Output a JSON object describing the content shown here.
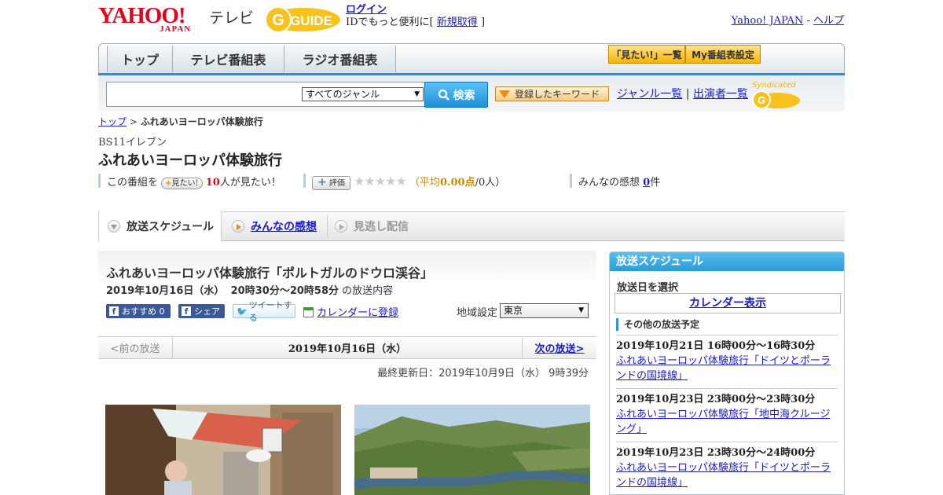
{
  "header": {
    "logo_text": "YAHOO!",
    "logo_sub": "JAPAN",
    "service": "テレビ",
    "gguide_logo": "GUIDE",
    "login": "ログイン",
    "login_note_pre": "IDでもっと便利に[",
    "register": "新規取得",
    "login_note_post": "]",
    "yahoo_japan": "Yahoo! JAPAN",
    "sep": "-",
    "help": "ヘルプ"
  },
  "nav": {
    "tabs": [
      "トップ",
      "テレビ番組表",
      "ラジオ番組表"
    ],
    "want_list": "「見たい!」一覧",
    "my_listing": "My番組表設定"
  },
  "search": {
    "genre": "すべてのジャンル",
    "button": "検索",
    "registered_keywords": "登録したキーワード",
    "genre_list": "ジャンル一覧",
    "divider": "|",
    "performer_list": "出演者一覧",
    "syndicated": "Syndicated"
  },
  "breadcrumb": {
    "home": "トップ",
    "sep": ">",
    "current": "ふれあいヨーロッパ体験旅行"
  },
  "program": {
    "channel": "BS11イレブン",
    "title": "ふれあいヨーロッパ体験旅行",
    "want_pre": "この番組を",
    "want_button": "見たい!",
    "want_count": "10",
    "want_post": "人が見たい！",
    "rate_button": "評価",
    "rating": 0,
    "rating_stars": "★★★★★",
    "avg_label": "（平均",
    "avg_value": "0.00点",
    "avg_post": "/0人）",
    "reviews_pre": "みんなの感想",
    "reviews_count": "0",
    "reviews_post": "件"
  },
  "subtabs": {
    "schedule": "放送スケジュール",
    "reviews": "みんなの感想",
    "stream": "見逃し配信"
  },
  "episode": {
    "title": "ふれあいヨーロッパ体験旅行「ポルトガルのドウロ渓谷」",
    "date": "2019年10月16日（水）",
    "time": "20時30分～20時58分",
    "date_post": "の放送内容",
    "recommend": "おすすめ 0",
    "share": "シェア",
    "tweet": "ツイートする",
    "calendar": "カレンダーに登録",
    "region_label": "地域設定",
    "region_value": "東京",
    "prev": "<前の放送",
    "current": "2019年10月16日（水）",
    "next": "次の放送>",
    "updated": "最終更新日：2019年10月9日（水） 9時39分"
  },
  "sidebar": {
    "heading": "放送スケジュール",
    "select_date": "放送日を選択",
    "calendar": "カレンダー表示",
    "other": "その他の放送予定",
    "items": [
      {
        "date": "2019年10月21日 16時00分～16時30分",
        "title": "ふれあいヨーロッパ体験旅行「ドイツとポーランドの国境線」"
      },
      {
        "date": "2019年10月23日 23時00分～23時30分",
        "title": "ふれあいヨーロッパ体験旅行「地中海クルージング」"
      },
      {
        "date": "2019年10月23日 23時30分～24時00分",
        "title": "ふれあいヨーロッパ体験旅行「ドイツとポーランドの国境線」"
      }
    ]
  },
  "colors": {
    "accent": "#1f93d3",
    "brand_red": "#e5001c",
    "link": "#1a1ac7",
    "orange": "#f08a00"
  },
  "icons": [
    "search-icon",
    "facebook-icon",
    "twitter-icon",
    "calendar-icon",
    "play-icon",
    "plus-icon",
    "star-icon"
  ]
}
